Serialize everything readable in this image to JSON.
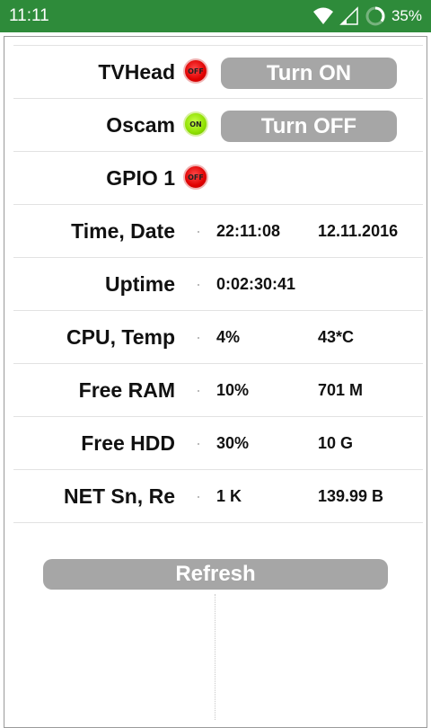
{
  "status_bar": {
    "time": "11:11",
    "battery": "35%",
    "color": "#2e8b3a"
  },
  "controls": [
    {
      "label": "TVHead",
      "state": "OFF",
      "button": "Turn ON"
    },
    {
      "label": "Oscam",
      "state": "ON",
      "button": "Turn OFF"
    },
    {
      "label": "GPIO 1",
      "state": "OFF"
    }
  ],
  "info_rows": [
    {
      "label": "Time, Date",
      "value1": "22:11:08",
      "value2": "12.11.2016"
    },
    {
      "label": "Uptime",
      "value1": "0:02:30:41",
      "value2": ""
    },
    {
      "label": "CPU, Temp",
      "value1": "4%",
      "value2": "43*C"
    },
    {
      "label": "Free RAM",
      "value1": "10%",
      "value2": "701 M"
    },
    {
      "label": "Free HDD",
      "value1": "30%",
      "value2": "10 G"
    },
    {
      "label": "NET Sn, Re",
      "value1": "1 K",
      "value2": "139.99 B"
    }
  ],
  "refresh_label": "Refresh",
  "colors": {
    "button": "#a6a6a6",
    "led_off": "#e00000",
    "led_on": "#8fe000"
  }
}
